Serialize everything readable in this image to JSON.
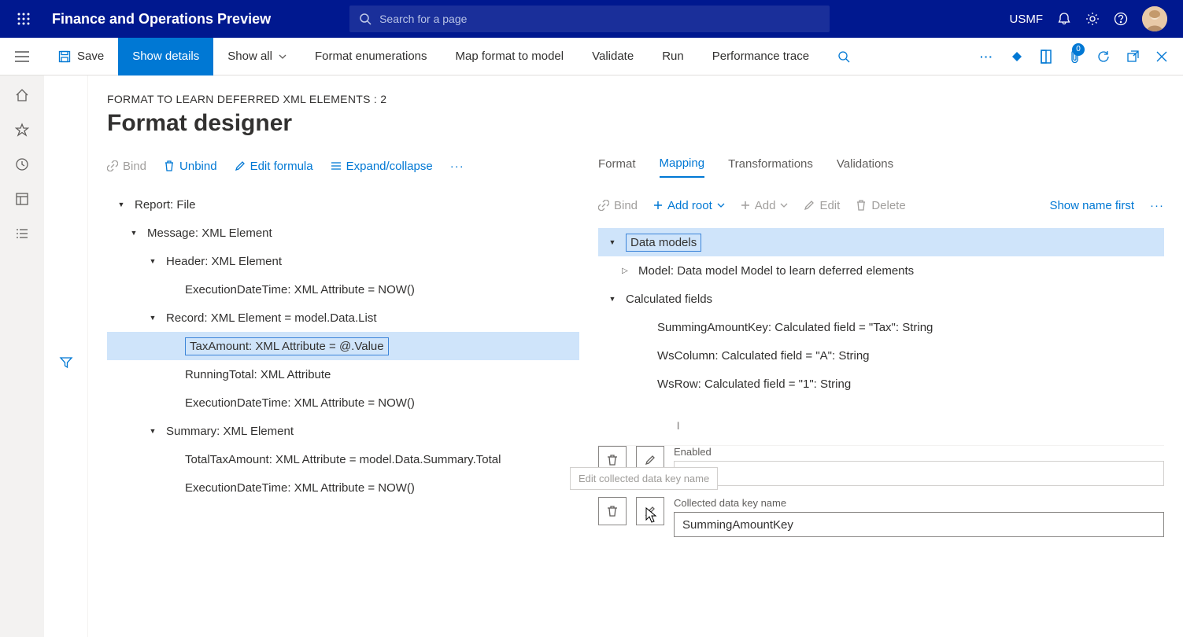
{
  "topbar": {
    "app_title": "Finance and Operations Preview",
    "search_placeholder": "Search for a page",
    "company": "USMF"
  },
  "cmdbar": {
    "save": "Save",
    "show_details": "Show details",
    "show_all": "Show all",
    "format_enum": "Format enumerations",
    "map_format": "Map format to model",
    "validate": "Validate",
    "run": "Run",
    "perf_trace": "Performance trace",
    "attach_count": "0"
  },
  "page": {
    "breadcrumb": "FORMAT TO LEARN DEFERRED XML ELEMENTS : 2",
    "title": "Format designer"
  },
  "left_toolbar": {
    "bind": "Bind",
    "unbind": "Unbind",
    "edit_formula": "Edit formula",
    "expand_collapse": "Expand/collapse"
  },
  "tree": {
    "report": "Report: File",
    "message": "Message: XML Element",
    "header": "Header: XML Element",
    "header_exec": "ExecutionDateTime: XML Attribute = NOW()",
    "record": "Record: XML Element = model.Data.List",
    "tax_amount": "TaxAmount: XML Attribute = @.Value",
    "running_total": "RunningTotal: XML Attribute",
    "record_exec": "ExecutionDateTime: XML Attribute = NOW()",
    "summary": "Summary: XML Element",
    "total_tax": "TotalTaxAmount: XML Attribute = model.Data.Summary.Total",
    "summary_exec": "ExecutionDateTime: XML Attribute = NOW()"
  },
  "tabs": {
    "format": "Format",
    "mapping": "Mapping",
    "transformations": "Transformations",
    "validations": "Validations"
  },
  "right_toolbar": {
    "bind": "Bind",
    "add_root": "Add root",
    "add": "Add",
    "edit": "Edit",
    "delete": "Delete",
    "show_name_first": "Show name first"
  },
  "right_tree": {
    "data_models": "Data models",
    "model": "Model: Data model Model to learn deferred elements",
    "calc_fields": "Calculated fields",
    "summing_key": "SummingAmountKey: Calculated field = \"Tax\": String",
    "ws_col": "WsColumn: Calculated field = \"A\": String",
    "ws_row": "WsRow: Calculated field = \"1\": String"
  },
  "props": {
    "enabled_label": "Enabled",
    "enabled_value": "",
    "key_label": "Collected data key name",
    "key_value": "SummingAmountKey"
  },
  "tooltip": "Edit collected data key name"
}
